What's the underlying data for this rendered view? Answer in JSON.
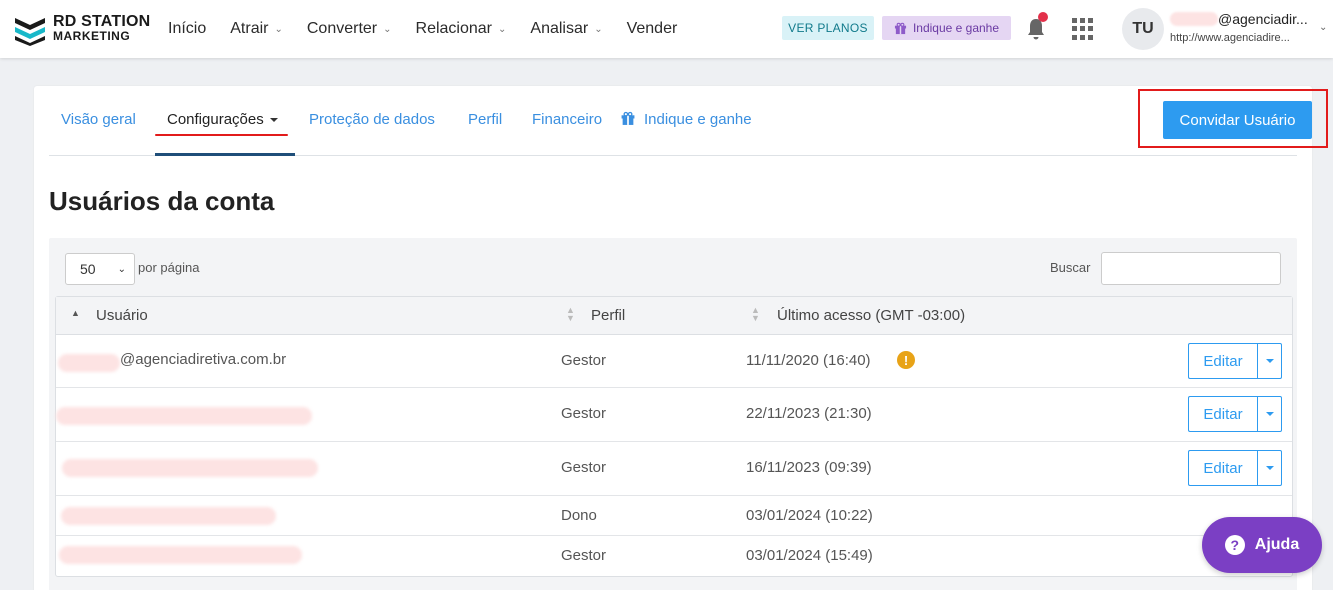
{
  "brand": {
    "line1": "RD STATION",
    "line2": "MARKETING"
  },
  "nav": {
    "items": [
      {
        "label": "Início",
        "has_menu": false
      },
      {
        "label": "Atrair",
        "has_menu": true
      },
      {
        "label": "Converter",
        "has_menu": true
      },
      {
        "label": "Relacionar",
        "has_menu": true
      },
      {
        "label": "Analisar",
        "has_menu": true
      },
      {
        "label": "Vender",
        "has_menu": false
      }
    ]
  },
  "header": {
    "ver_planos": "VER PLANOS",
    "indique": "Indique e ganhe",
    "avatar_initials": "TU",
    "user_email": "@agenciadir...",
    "user_url": "http://www.agenciadire..."
  },
  "tabs": [
    {
      "label": "Visão geral",
      "active": false
    },
    {
      "label": "Configurações",
      "active": true
    },
    {
      "label": "Proteção de dados",
      "active": false
    },
    {
      "label": "Perfil",
      "active": false
    },
    {
      "label": "Financeiro",
      "active": false
    },
    {
      "label": "Indique e ganhe",
      "active": false
    }
  ],
  "actions": {
    "invite_label": "Convidar Usuário"
  },
  "page": {
    "title": "Usuários da conta"
  },
  "table_controls": {
    "per_page_value": "50",
    "per_page_label": "por página",
    "search_label": "Buscar",
    "search_value": ""
  },
  "table": {
    "columns": [
      "Usuário",
      "Perfil",
      "Último acesso (GMT -03:00)"
    ],
    "rows": [
      {
        "user": "@agenciadiretiva.com.br",
        "profile": "Gestor",
        "last_access": "11/11/2020 (16:40)",
        "warning": true,
        "editable": true
      },
      {
        "user": "",
        "profile": "Gestor",
        "last_access": "22/11/2023 (21:30)",
        "warning": false,
        "editable": true
      },
      {
        "user": "",
        "profile": "Gestor",
        "last_access": "16/11/2023 (09:39)",
        "warning": false,
        "editable": true
      },
      {
        "user": "",
        "profile": "Dono",
        "last_access": "03/01/2024 (10:22)",
        "warning": false,
        "editable": false
      },
      {
        "user": "",
        "profile": "Gestor",
        "last_access": "03/01/2024 (15:49)",
        "warning": false,
        "editable": false
      }
    ],
    "edit_label": "Editar",
    "warning_glyph": "!"
  },
  "help": {
    "label": "Ajuda",
    "glyph": "?"
  },
  "colors": {
    "accent": "#2d9bf0",
    "link": "#3a8fe0",
    "help": "#7b3fc4",
    "highlight": "#e21b1b"
  }
}
